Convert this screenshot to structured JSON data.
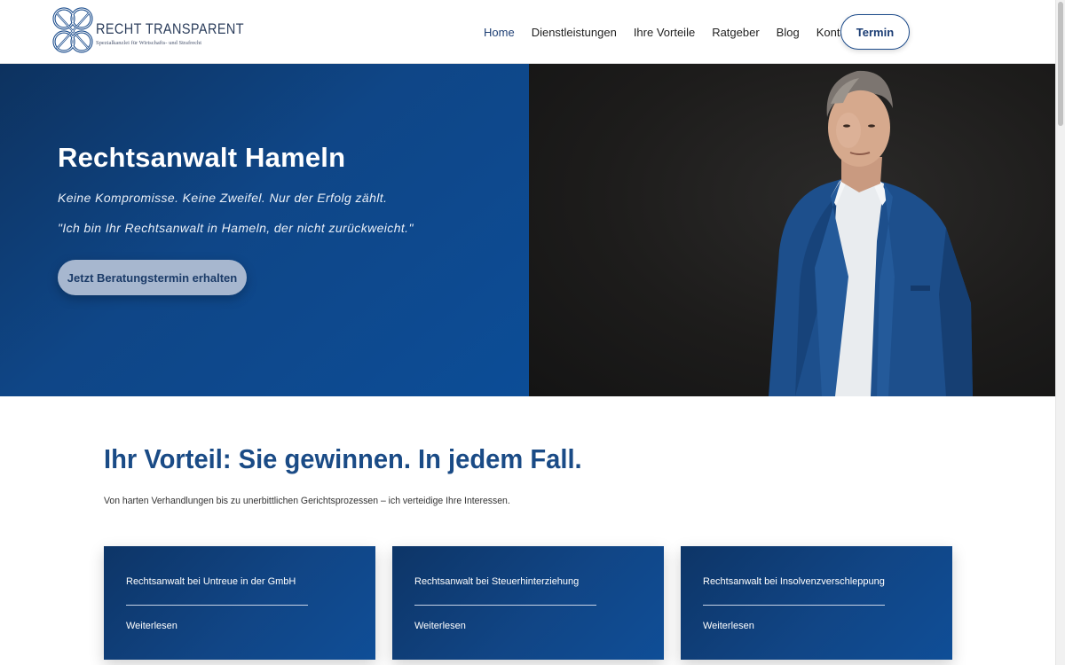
{
  "brand": {
    "name": "RECHT TRANSPARENT",
    "tagline": "Spezialkanzlei für Wirtschafts- und Strafrecht",
    "icon": "interlaced-knot-logo",
    "color": "#1b4a8a"
  },
  "nav": {
    "items": [
      {
        "label": "Home",
        "active": true
      },
      {
        "label": "Dienstleistungen",
        "active": false
      },
      {
        "label": "Ihre Vorteile",
        "active": false
      },
      {
        "label": "Ratgeber",
        "active": false
      },
      {
        "label": "Blog",
        "active": false
      },
      {
        "label": "Kontakt",
        "active": false
      }
    ],
    "cta_label": "Termin"
  },
  "hero": {
    "title": "Rechtsanwalt Hameln",
    "tagline": "Keine Kompromisse. Keine Zweifel. Nur der Erfolg zählt.",
    "quote": "\"Ich bin Ihr Rechtsanwalt in Hameln, der nicht zurückweicht.\"",
    "cta_label": "Jetzt Beratungstermin erhalten",
    "image": "lawyer-portrait"
  },
  "benefits": {
    "title": "Ihr Vorteil: Sie gewinnen. In jedem Fall.",
    "subtitle": "Von harten Verhandlungen bis zu unerbittlichen Gerichtsprozessen – ich verteidige Ihre Interessen."
  },
  "cards": [
    {
      "title": "Rechtsanwalt bei Untreue in der GmbH",
      "link": "Weiterlesen"
    },
    {
      "title": "Rechtsanwalt bei Steuerhinterziehung",
      "link": "Weiterlesen"
    },
    {
      "title": "Rechtsanwalt bei Insolvenzverschleppung",
      "link": "Weiterlesen"
    }
  ],
  "colors": {
    "primary": "#1a4b86",
    "hero_bg": "#0f4687",
    "cta_bg": "#a7b7cf"
  }
}
